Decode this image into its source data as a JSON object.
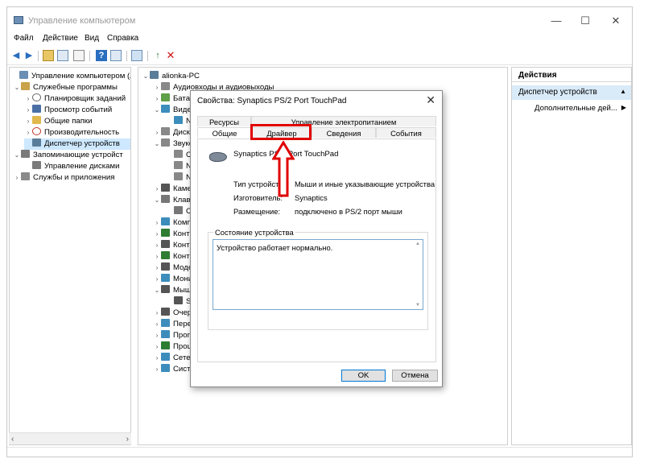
{
  "window": {
    "title": "Управление компьютером",
    "minimize": "—",
    "maximize": "☐",
    "close": "✕"
  },
  "menu": [
    "Файл",
    "Действие",
    "Вид",
    "Справка"
  ],
  "left_tree": [
    {
      "label": "Управление компьютером (л",
      "twisty": "",
      "color": "#6b8fb5"
    },
    {
      "label": "Служебные программы",
      "twisty": "⌄",
      "color": "#c9a24b"
    },
    {
      "label": "Планировщик заданий",
      "twisty": "›",
      "color": "#6b6b6b"
    },
    {
      "label": "Просмотр событий",
      "twisty": "›",
      "color": "#4a6fa5"
    },
    {
      "label": "Общие папки",
      "twisty": "›",
      "color": "#e0b84d"
    },
    {
      "label": "Производительность",
      "twisty": "›",
      "color": "#c0392b"
    },
    {
      "label": "Диспетчер устройств",
      "twisty": "",
      "color": "#5a7d9a"
    },
    {
      "label": "Запоминающие устройст",
      "twisty": "⌄",
      "color": "#7a7a7a"
    },
    {
      "label": "Управление дисками",
      "twisty": "",
      "color": "#7a7a7a"
    },
    {
      "label": "Службы и приложения",
      "twisty": "›",
      "color": "#8a8a8a"
    }
  ],
  "left_scroll": {
    "left": "‹",
    "right": "›"
  },
  "mid_tree": [
    {
      "label": "alionka-PC",
      "twisty": "⌄",
      "color": "#5a7d9a"
    },
    {
      "label": "Аудиовходы и аудиовыходы",
      "twisty": "›",
      "color": "#888"
    },
    {
      "label": "Батаре",
      "twisty": "›",
      "color": "#5fa048"
    },
    {
      "label": "Видеоа",
      "twisty": "⌄",
      "color": "#3c8dbc"
    },
    {
      "label": "NV",
      "twisty": "",
      "color": "#3c8dbc"
    },
    {
      "label": "Диско",
      "twisty": "›",
      "color": "#888"
    },
    {
      "label": "Звуко",
      "twisty": "⌄",
      "color": "#888"
    },
    {
      "label": "Co",
      "twisty": "",
      "color": "#888"
    },
    {
      "label": "NV",
      "twisty": "",
      "color": "#888"
    },
    {
      "label": "NV",
      "twisty": "",
      "color": "#888"
    },
    {
      "label": "Камер",
      "twisty": "›",
      "color": "#555"
    },
    {
      "label": "Клавиа",
      "twisty": "⌄",
      "color": "#777"
    },
    {
      "label": "Ста",
      "twisty": "",
      "color": "#777"
    },
    {
      "label": "Компь",
      "twisty": "›",
      "color": "#3c8dbc"
    },
    {
      "label": "Контро",
      "twisty": "›",
      "color": "#2e7d32"
    },
    {
      "label": "Контро",
      "twisty": "›",
      "color": "#555"
    },
    {
      "label": "Контро",
      "twisty": "›",
      "color": "#2e7d32"
    },
    {
      "label": "Модем",
      "twisty": "›",
      "color": "#555"
    },
    {
      "label": "Монит",
      "twisty": "›",
      "color": "#3c8dbc"
    },
    {
      "label": "Мыши",
      "twisty": "⌄",
      "color": "#555"
    },
    {
      "label": "Syr",
      "twisty": "",
      "color": "#555"
    },
    {
      "label": "Очеред",
      "twisty": "›",
      "color": "#555"
    },
    {
      "label": "Перен",
      "twisty": "›",
      "color": "#3c8dbc"
    },
    {
      "label": "Прогр",
      "twisty": "›",
      "color": "#3c8dbc"
    },
    {
      "label": "Проце",
      "twisty": "›",
      "color": "#2e7d32"
    },
    {
      "label": "Сетевы",
      "twisty": "›",
      "color": "#3c8dbc"
    },
    {
      "label": "Систем",
      "twisty": "›",
      "color": "#3c8dbc"
    }
  ],
  "actions": {
    "header": "Действия",
    "section": "Диспетчер устройств",
    "section_caret": "▲",
    "item": "Дополнительные дей...",
    "item_arrow": "▶"
  },
  "dialog": {
    "title": "Свойства: Synaptics PS/2 Port TouchPad",
    "close": "✕",
    "tabs_top": [
      "Ресурсы",
      "Управление электропитанием"
    ],
    "tabs_bottom": [
      "Общие",
      "Драйвер",
      "Сведения",
      "События"
    ],
    "device_name": "Synaptics PS/2 Port TouchPad",
    "props": [
      {
        "label": "Тип устройства:",
        "value": "Мыши и иные указывающие устройства"
      },
      {
        "label": "Изготовитель:",
        "value": "Synaptics"
      },
      {
        "label": "Размещение:",
        "value": "подключено в PS/2 порт мыши"
      }
    ],
    "status_label": "Состояние устройства",
    "status_text": "Устройство работает нормально.",
    "scroll_up": "▲",
    "scroll_down": "▼",
    "ok": "OK",
    "cancel": "Отмена"
  },
  "colors": {
    "annotation": "#e00000",
    "selection": "#cde8ff",
    "actions_bar": "#d9eaf8"
  }
}
